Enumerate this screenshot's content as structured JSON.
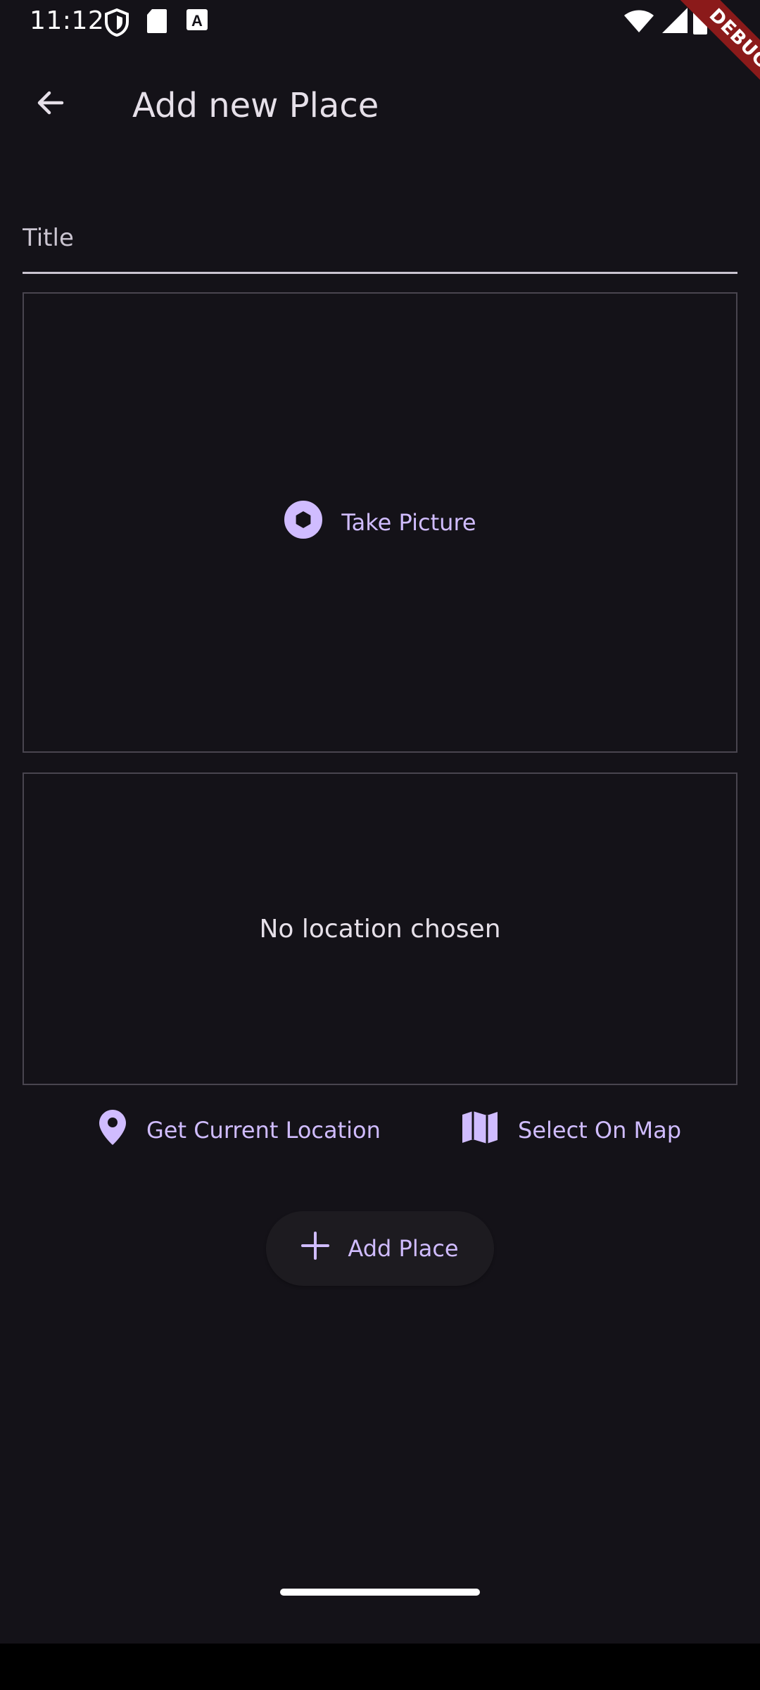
{
  "status_bar": {
    "time": "11:12",
    "icons": [
      "shield-icon",
      "sd-card-icon",
      "font-a-icon",
      "wifi-icon",
      "signal-icon",
      "battery-icon"
    ]
  },
  "debug_banner": {
    "label": "DEBUG"
  },
  "app_bar": {
    "title": "Add new Place",
    "back_icon": "arrow-left-icon"
  },
  "form": {
    "title_placeholder": "Title",
    "title_value": ""
  },
  "image_picker": {
    "button_label": "Take Picture",
    "icon": "camera-shutter-icon"
  },
  "location": {
    "status_text": "No location chosen",
    "current_location_label": "Get Current Location",
    "current_location_icon": "location-pin-icon",
    "select_on_map_label": "Select On Map",
    "select_on_map_icon": "map-icon"
  },
  "submit": {
    "label": "Add Place",
    "icon": "plus-icon"
  },
  "colors": {
    "background": "#141218",
    "accent": "#d0bcff",
    "on_surface": "#e6e0e9",
    "outline": "#49454f",
    "debug_banner": "#8b1a1a"
  }
}
